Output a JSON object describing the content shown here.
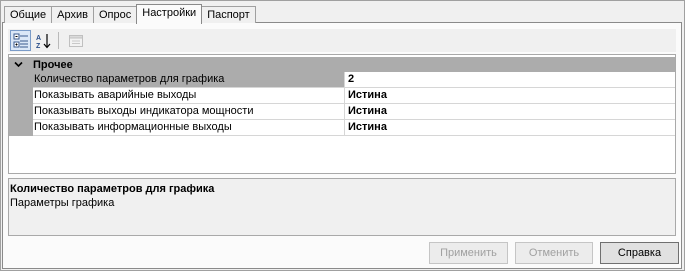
{
  "tabs": [
    {
      "label": "Общие"
    },
    {
      "label": "Архив"
    },
    {
      "label": "Опрос"
    },
    {
      "label": "Настройки"
    },
    {
      "label": "Паспорт"
    }
  ],
  "active_tab": "Настройки",
  "toolbar": {
    "categorized_icon": "categorized-view-icon",
    "alphabetical_icon": "sort-alphabetical-icon",
    "property_pages_icon": "property-pages-icon"
  },
  "grid": {
    "category": {
      "label": "Прочее",
      "expanded": true
    },
    "properties": [
      {
        "name": "Количество параметров для графика",
        "value": "2",
        "selected": true
      },
      {
        "name": "Показывать аварийные выходы",
        "value": "Истина",
        "selected": false
      },
      {
        "name": "Показывать выходы индикатора мощности",
        "value": "Истина",
        "selected": false
      },
      {
        "name": "Показывать информационные выходы",
        "value": "Истина",
        "selected": false
      }
    ]
  },
  "description": {
    "title": "Количество параметров для графика",
    "text": "Параметры графика"
  },
  "buttons": {
    "apply": "Применить",
    "cancel": "Отменить",
    "help": "Справка"
  },
  "colors": {
    "gutter": "#acacac",
    "panel": "#f0f0f0"
  }
}
